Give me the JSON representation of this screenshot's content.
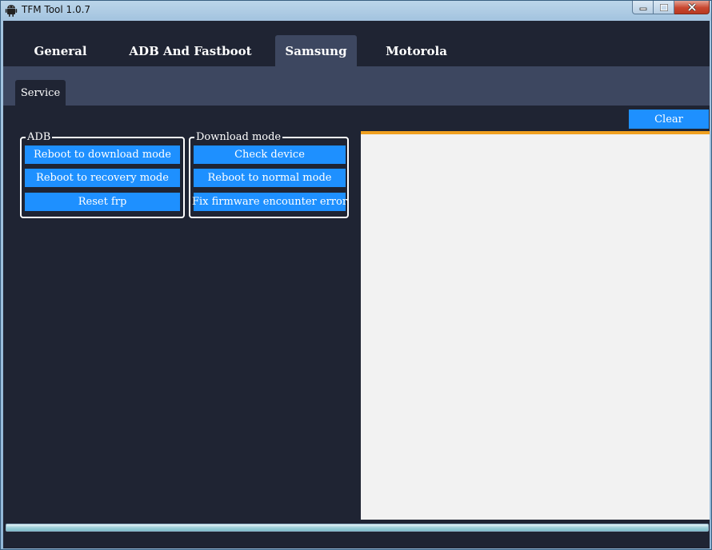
{
  "window": {
    "title": "TFM Tool 1.0.7",
    "icon": "android-icon"
  },
  "tabs": [
    {
      "label": "General",
      "active": false
    },
    {
      "label": "ADB And Fastboot",
      "active": false
    },
    {
      "label": "Samsung",
      "active": true
    },
    {
      "label": "Motorola",
      "active": false
    }
  ],
  "subtabs": [
    {
      "label": "Service",
      "active": true
    }
  ],
  "adb_group": {
    "label": "ADB",
    "buttons": [
      "Reboot to download mode",
      "Reboot to recovery mode",
      "Reset frp"
    ]
  },
  "download_group": {
    "label": "Download mode",
    "buttons": [
      "Check device",
      "Reboot to normal mode",
      "Fix firmware encounter error"
    ]
  },
  "log": {
    "clear_label": "Clear",
    "content": ""
  },
  "progress": {
    "value": 1.0
  },
  "colors": {
    "background": "#1f2433",
    "tab_active": "#3d4760",
    "button": "#1e90ff",
    "log_accent": "#f0a020"
  }
}
